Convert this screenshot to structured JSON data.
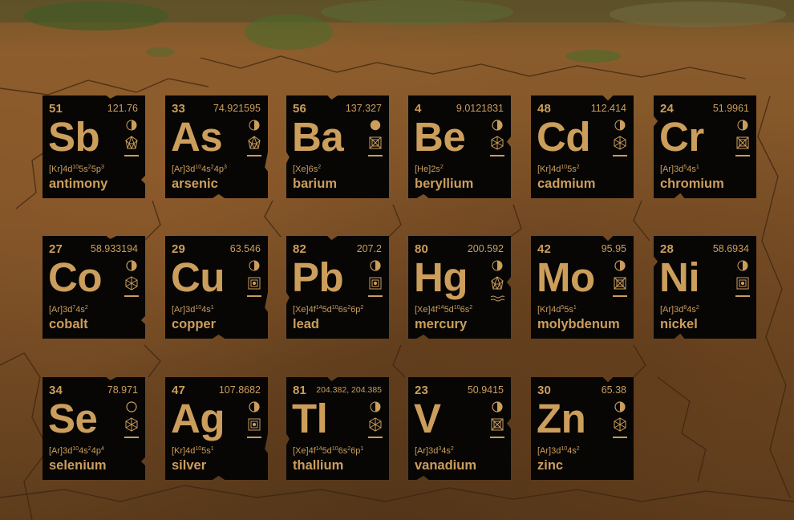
{
  "colors": {
    "tile_bg": "#070605",
    "tile_text": "#cc9e5c",
    "soil": "#7d5127",
    "grass": "#4c5a2a"
  },
  "elements": [
    {
      "number": "51",
      "mass": "121.76",
      "symbol": "Sb",
      "core": "[Kr]",
      "config": [
        [
          "4d",
          "10"
        ],
        [
          "5s",
          "2"
        ],
        [
          "5p",
          "3"
        ]
      ],
      "name": "antimony",
      "state_icon": "solid-half-icon",
      "crystal_icon": "trigonal-icon"
    },
    {
      "number": "33",
      "mass": "74.921595",
      "symbol": "As",
      "core": "[Ar]",
      "config": [
        [
          "3d",
          "10"
        ],
        [
          "4s",
          "2"
        ],
        [
          "4p",
          "3"
        ]
      ],
      "name": "arsenic",
      "state_icon": "solid-half-icon",
      "crystal_icon": "trigonal-icon"
    },
    {
      "number": "56",
      "mass": "137.327",
      "symbol": "Ba",
      "core": "[Xe]",
      "config": [
        [
          "6s",
          "2"
        ]
      ],
      "name": "barium",
      "state_icon": "solid-filled-icon",
      "crystal_icon": "body-centered-cubic-icon"
    },
    {
      "number": "4",
      "mass": "9.0121831",
      "symbol": "Be",
      "core": "[He]",
      "config": [
        [
          "2s",
          "2"
        ]
      ],
      "name": "beryllium",
      "state_icon": "solid-split-icon",
      "crystal_icon": "hexagonal-icon"
    },
    {
      "number": "48",
      "mass": "112.414",
      "symbol": "Cd",
      "core": "[Kr]",
      "config": [
        [
          "4d",
          "10"
        ],
        [
          "5s",
          "2"
        ]
      ],
      "name": "cadmium",
      "state_icon": "solid-half-icon",
      "crystal_icon": "hexagonal-icon"
    },
    {
      "number": "24",
      "mass": "51.9961",
      "symbol": "Cr",
      "core": "[Ar]",
      "config": [
        [
          "3d",
          "5"
        ],
        [
          "4s",
          "1"
        ]
      ],
      "name": "chromium",
      "state_icon": "solid-half-icon",
      "crystal_icon": "body-centered-cubic-icon"
    },
    {
      "number": "27",
      "mass": "58.933194",
      "symbol": "Co",
      "core": "[Ar]",
      "config": [
        [
          "3d",
          "7"
        ],
        [
          "4s",
          "2"
        ]
      ],
      "name": "cobalt",
      "state_icon": "solid-split-icon",
      "crystal_icon": "hexagonal-icon"
    },
    {
      "number": "29",
      "mass": "63.546",
      "symbol": "Cu",
      "core": "[Ar]",
      "config": [
        [
          "3d",
          "10"
        ],
        [
          "4s",
          "1"
        ]
      ],
      "name": "copper",
      "state_icon": "solid-half-icon",
      "crystal_icon": "face-centered-cubic-icon"
    },
    {
      "number": "82",
      "mass": "207.2",
      "symbol": "Pb",
      "core": "[Xe]",
      "config": [
        [
          "4f",
          "14"
        ],
        [
          "5d",
          "10"
        ],
        [
          "6s",
          "2"
        ],
        [
          "6p",
          "2"
        ]
      ],
      "name": "lead",
      "state_icon": "solid-split-icon",
      "crystal_icon": "face-centered-cubic-icon"
    },
    {
      "number": "80",
      "mass": "200.592",
      "symbol": "Hg",
      "core": "[Xe]",
      "config": [
        [
          "4f",
          "14"
        ],
        [
          "5d",
          "10"
        ],
        [
          "6s",
          "2"
        ]
      ],
      "name": "mercury",
      "state_icon": "solid-half-icon",
      "crystal_icon": "trigonal-icon",
      "liquid": true
    },
    {
      "number": "42",
      "mass": "95.95",
      "symbol": "Mo",
      "core": "[Kr]",
      "config": [
        [
          "4d",
          "5"
        ],
        [
          "5s",
          "1"
        ]
      ],
      "name": "molybdenum",
      "state_icon": "solid-split-icon",
      "crystal_icon": "body-centered-cubic-icon"
    },
    {
      "number": "28",
      "mass": "58.6934",
      "symbol": "Ni",
      "core": "[Ar]",
      "config": [
        [
          "3d",
          "8"
        ],
        [
          "4s",
          "2"
        ]
      ],
      "name": "nickel",
      "state_icon": "solid-half-icon",
      "crystal_icon": "face-centered-cubic-icon"
    },
    {
      "number": "34",
      "mass": "78.971",
      "symbol": "Se",
      "core": "[Ar]",
      "config": [
        [
          "3d",
          "10"
        ],
        [
          "4s",
          "2"
        ],
        [
          "4p",
          "4"
        ]
      ],
      "name": "selenium",
      "state_icon": "nonmetal-ring-icon",
      "crystal_icon": "hexagonal-icon"
    },
    {
      "number": "47",
      "mass": "107.8682",
      "symbol": "Ag",
      "core": "[Kr]",
      "config": [
        [
          "4d",
          "10"
        ],
        [
          "5s",
          "1"
        ]
      ],
      "name": "silver",
      "state_icon": "solid-split-icon",
      "crystal_icon": "face-centered-cubic-icon"
    },
    {
      "number": "81",
      "mass": "204.382, 204.385",
      "symbol": "Tl",
      "core": "[Xe]",
      "config": [
        [
          "4f",
          "14"
        ],
        [
          "5d",
          "10"
        ],
        [
          "6s",
          "2"
        ],
        [
          "6p",
          "1"
        ]
      ],
      "name": "thallium",
      "state_icon": "solid-half-icon",
      "crystal_icon": "hexagonal-icon"
    },
    {
      "number": "23",
      "mass": "50.9415",
      "symbol": "V",
      "core": "[Ar]",
      "config": [
        [
          "3d",
          "3"
        ],
        [
          "4s",
          "2"
        ]
      ],
      "name": "vanadium",
      "state_icon": "solid-split-icon",
      "crystal_icon": "body-centered-cubic-icon"
    },
    {
      "number": "30",
      "mass": "65.38",
      "symbol": "Zn",
      "core": "[Ar]",
      "config": [
        [
          "3d",
          "10"
        ],
        [
          "4s",
          "2"
        ]
      ],
      "name": "zinc",
      "state_icon": "solid-split-icon",
      "crystal_icon": "hexagonal-icon"
    }
  ]
}
